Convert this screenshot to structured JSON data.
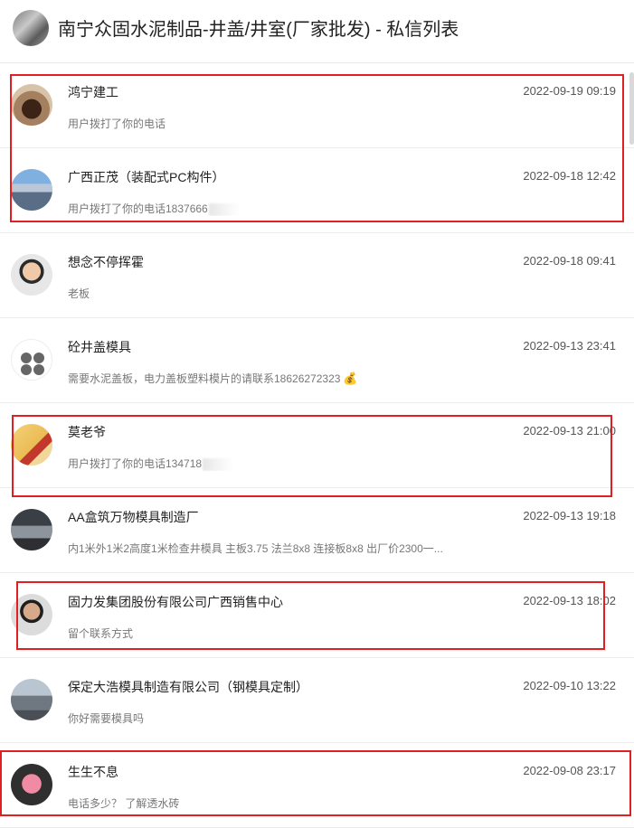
{
  "header": {
    "title": "南宁众固水泥制品-井盖/井室(厂家批发) - 私信列表"
  },
  "conversations": [
    {
      "name": "鸿宁建工",
      "time": "2022-09-19 09:19",
      "message": "用户拨打了你的电话",
      "highlighted": true
    },
    {
      "name": "广西正茂（装配式PC构件）",
      "time": "2022-09-18 12:42",
      "message": "用户拨打了你的电话1837666",
      "highlighted": true,
      "redacted": true
    },
    {
      "name": "想念不停挥霍",
      "time": "2022-09-18 09:41",
      "message": "老板",
      "highlighted": false
    },
    {
      "name": "砼井盖模具",
      "time": "2022-09-13 23:41",
      "message": "需要水泥盖板，电力盖板塑料模片的请联系18626272323",
      "highlighted": false,
      "emoji": "💰"
    },
    {
      "name": "莫老爷",
      "time": "2022-09-13 21:00",
      "message": "用户拨打了你的电话134718",
      "highlighted": true,
      "redacted": true
    },
    {
      "name": "AA盒筑万物模具制造厂",
      "time": "2022-09-13 19:18",
      "message": "内1米外1米2高度1米检查井模具 主板3.75 法兰8x8 连接板8x8 出厂价2300一...",
      "highlighted": false
    },
    {
      "name": "固力发集团股份有限公司广西销售中心",
      "time": "2022-09-13 18:02",
      "message": "留个联系方式",
      "highlighted": true
    },
    {
      "name": "保定大浩模具制造有限公司（钢模具定制）",
      "time": "2022-09-10 13:22",
      "message": "你好需要模具吗",
      "highlighted": false
    },
    {
      "name": "生生不息",
      "time": "2022-09-08 23:17",
      "message": "电话多少？ 了解透水砖",
      "highlighted": true
    }
  ],
  "colors": {
    "highlight": "#e02020",
    "divider": "#ececec",
    "time": "#555555",
    "message": "#777777"
  }
}
